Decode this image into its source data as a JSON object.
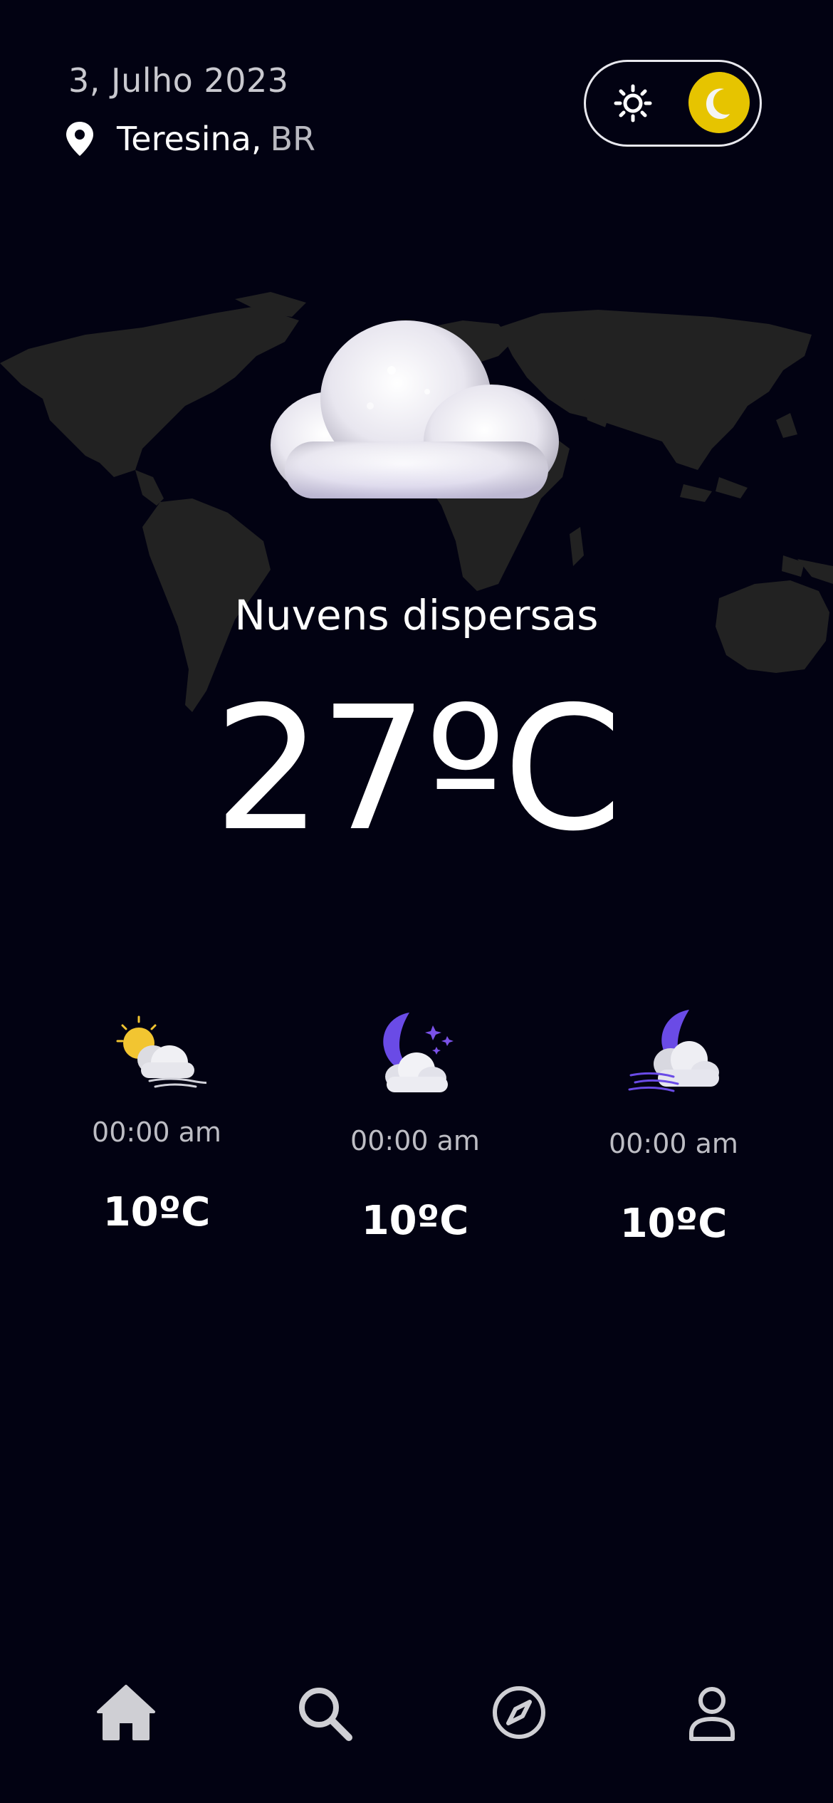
{
  "header": {
    "date": "3, Julho 2023",
    "city": "Teresina,",
    "country": "BR",
    "location_icon": "map-pin-icon"
  },
  "theme_toggle": {
    "light_icon": "sun-icon",
    "dark_icon": "moon-icon",
    "selected": "dark",
    "accent_color": "#e6c400"
  },
  "current": {
    "icon": "cloud-icon",
    "condition": "Nuvens dispersas",
    "temperature": "27ºC"
  },
  "forecast": [
    {
      "icon": "sun-cloud-wind-icon",
      "time": "00:00 am",
      "temp": "10ºC"
    },
    {
      "icon": "moon-stars-cloud-icon",
      "time": "00:00 am",
      "temp": "10ºC"
    },
    {
      "icon": "moon-cloud-wind-icon",
      "time": "00:00 am",
      "temp": "10ºC"
    }
  ],
  "nav": [
    {
      "icon": "home-icon",
      "active": true
    },
    {
      "icon": "search-icon",
      "active": false
    },
    {
      "icon": "compass-icon",
      "active": false
    },
    {
      "icon": "profile-icon",
      "active": false
    }
  ],
  "colors": {
    "background": "#020212",
    "map": "#222222",
    "moon_purple": "#6a4be6"
  }
}
